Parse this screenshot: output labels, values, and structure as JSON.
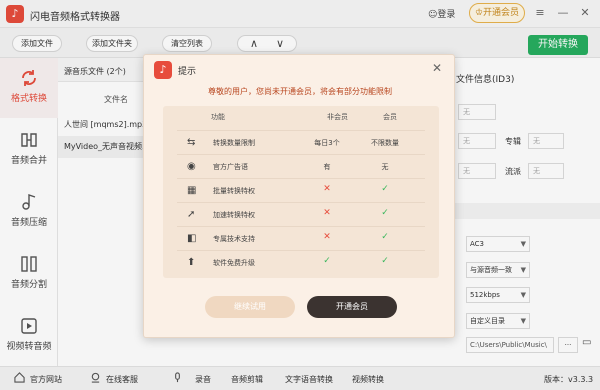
{
  "app": {
    "title": "闪电音频格式转换器",
    "logo_icon": "music-note-icon"
  },
  "titlebar": {
    "login": "登录",
    "vip": "开通会员"
  },
  "toolbar": {
    "add_file": "添加文件",
    "add_folder": "添加文件夹",
    "clear_list": "清空列表",
    "up": "∧",
    "down": "∨",
    "start": "开始转换"
  },
  "sidebar": {
    "items": [
      {
        "label": "格式转换",
        "icon": "refresh-icon",
        "active": true
      },
      {
        "label": "音频合并",
        "icon": "merge-icon"
      },
      {
        "label": "音频压缩",
        "icon": "compress-icon"
      },
      {
        "label": "音频分割",
        "icon": "split-icon"
      },
      {
        "label": "视频转音频",
        "icon": "video-icon"
      }
    ]
  },
  "filelist": {
    "title": "源音乐文件 (2个)",
    "col_name": "文件名",
    "rows": [
      "人世间 [mqms2].mp3",
      "MyVideo_无声音视频.mp4"
    ]
  },
  "right": {
    "id3_title": "文件信息(ID3)",
    "placeholder": "无",
    "label_album": "专辑",
    "label_genre": "流派",
    "format": "AC3",
    "sample": "与源音频一致",
    "bitrate": "512kbps",
    "output_dir": "自定义目录",
    "path": "C:\\Users\\Public\\Music\\",
    "more": "···"
  },
  "bottombar": {
    "website": "官方网站",
    "service": "在线客服",
    "record": "录音",
    "edit": "音频剪辑",
    "speech": "文字语音转换",
    "video": "视频转换",
    "version": "版本：v3.3.3"
  },
  "dialog": {
    "title": "提示",
    "message": "尊敬的用户，您尚未开通会员，将会有部分功能限制",
    "col_feature": "功能",
    "col_free": "非会员",
    "col_vip": "会员",
    "rows": [
      {
        "feature": "转换数量限制",
        "free": "每日3个",
        "vip": "不限数量",
        "icon": "swap-icon"
      },
      {
        "feature": "官方广告语",
        "free": "有",
        "vip": "无",
        "icon": "ad-icon"
      },
      {
        "feature": "批量转换特权",
        "free": "✕",
        "vip": "✓",
        "icon": "grid-icon"
      },
      {
        "feature": "加速转换特权",
        "free": "✕",
        "vip": "✓",
        "icon": "rocket-icon"
      },
      {
        "feature": "专属技术支持",
        "free": "✕",
        "vip": "✓",
        "icon": "support-icon"
      },
      {
        "feature": "软件免费升级",
        "free": "✓",
        "vip": "✓",
        "icon": "upgrade-icon"
      }
    ],
    "trial": "继续试用",
    "open_vip": "开通会员"
  },
  "colors": {
    "accent": "#e74c3c",
    "green": "#27ae60",
    "dialog_bg": "#fbf0e6"
  }
}
